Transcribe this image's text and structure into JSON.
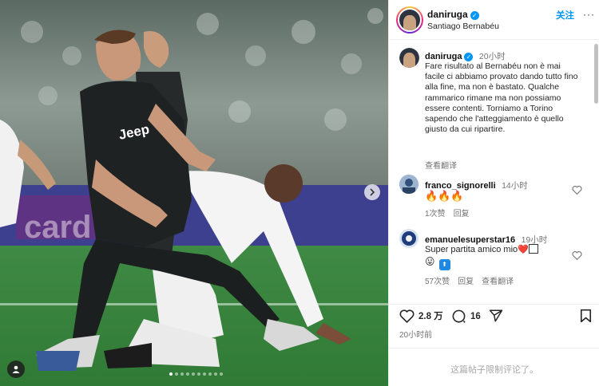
{
  "post": {
    "username": "daniruga",
    "location": "Santiago Bernabéu",
    "follow_label": "关注",
    "more_label": "···"
  },
  "caption": {
    "username": "daniruga",
    "time": "20小时",
    "text": "Fare risultato al Bernabéu non è mai facile ci abbiamo provato dando tutto fino alla fine, ma non è bastato. Qualche rammarico rimane ma non possiamo essere contenti. Torniamo a Torino sapendo che l'atteggiamento è quello giusto da cui ripartire.",
    "translate_label": "查看翻译"
  },
  "comments": [
    {
      "username": "franco_signorelli",
      "time": "14小时",
      "text": "🔥🔥🔥",
      "likes": "1次赞",
      "reply_label": "回复"
    },
    {
      "username": "emanuelesuperstar16",
      "time": "19小时",
      "text": "Super partita amico mio❤️",
      "text2": "😛",
      "likes": "57次赞",
      "reply_label": "回复",
      "translate_label": "查看翻译"
    }
  ],
  "actions": {
    "likes_count": "2.8 万",
    "comments_count": "16",
    "timestamp": "20小时前"
  },
  "footer": {
    "restricted_text": "这篇帖子限制评论了。"
  },
  "icons": {
    "verified": "verified-badge-icon",
    "like": "heart-icon",
    "comment": "comment-bubble-icon",
    "share": "paper-plane-icon",
    "save": "bookmark-icon",
    "next": "chevron-right-icon",
    "tag": "user-tag-icon"
  },
  "colors": {
    "accent": "#0095f6",
    "muted": "#737373",
    "restricted": "#a8a8a8"
  }
}
